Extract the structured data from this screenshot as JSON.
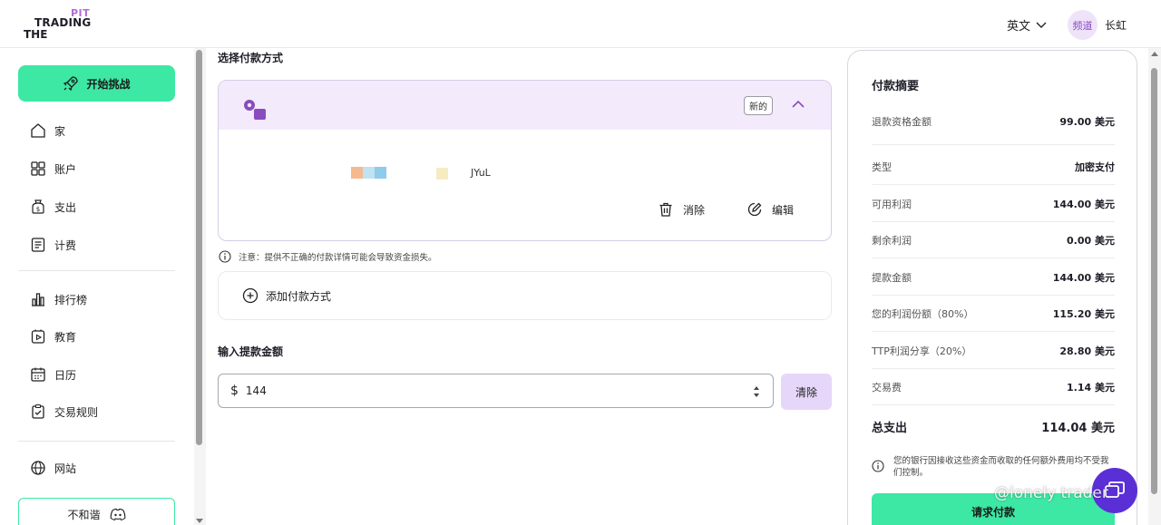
{
  "header": {
    "logo": {
      "top": "PIT",
      "middle": "TRADING",
      "bottom": "THE"
    },
    "language": "英文",
    "avatar_text": "频道",
    "username": "长虹"
  },
  "sidebar": {
    "start_button": "开始挑战",
    "items": [
      {
        "label": "家",
        "icon": "home-icon"
      },
      {
        "label": "账户",
        "icon": "grid-icon"
      },
      {
        "label": "支出",
        "icon": "dollar-bag-icon"
      },
      {
        "label": "计费",
        "icon": "billing-icon"
      },
      {
        "label": "排行榜",
        "icon": "leaderboard-icon"
      },
      {
        "label": "教育",
        "icon": "education-icon"
      },
      {
        "label": "日历",
        "icon": "calendar-icon"
      },
      {
        "label": "交易规则",
        "icon": "rules-icon"
      },
      {
        "label": "网站",
        "icon": "globe-icon"
      }
    ],
    "discord_button": "不和谐"
  },
  "main": {
    "payment_method_title": "选择付款方式",
    "method_card": {
      "badge": "新的",
      "address_fragment": "JYuL",
      "delete_label": "消除",
      "edit_label": "编辑"
    },
    "notice": "注意：提供不正确的付款详情可能会导致资金损失。",
    "add_method_label": "添加付款方式",
    "amount_title": "输入提款金额",
    "amount_currency": "$",
    "amount_value": "144",
    "clear_button": "清除"
  },
  "summary": {
    "title": "付款摘要",
    "rows": [
      {
        "label": "退款资格金额",
        "value": "99.00 美元"
      },
      {
        "label": "类型",
        "value": "加密支付"
      },
      {
        "label": "可用利润",
        "value": "144.00 美元"
      },
      {
        "label": "剩余利润",
        "value": "0.00 美元"
      },
      {
        "label": "提款金额",
        "value": "144.00 美元"
      },
      {
        "label": "您的利润份额（80%）",
        "value": "115.20 美元"
      },
      {
        "label": "TTP利润分享（20%）",
        "value": "28.80 美元"
      },
      {
        "label": "交易费",
        "value": "1.14 美元"
      }
    ],
    "total": {
      "label": "总支出",
      "value": "114.04 美元"
    },
    "note": "您的银行因接收这些资金而收取的任何额外费用均不受我们控制。",
    "request_button": "请求付款"
  },
  "watermark": "@lonely trader",
  "colors": {
    "accent_green": "#3ce8a3",
    "accent_purple": "#8a4bbf",
    "panel_lavender": "#f3eafc"
  }
}
